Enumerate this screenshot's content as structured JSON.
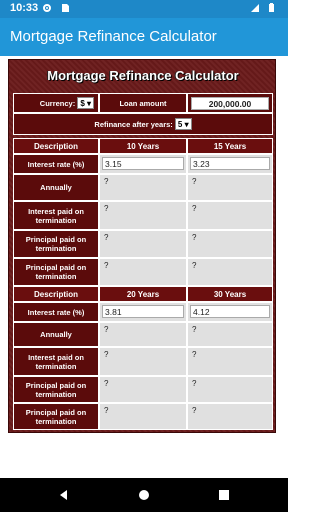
{
  "status": {
    "time": "10:33"
  },
  "appbar": {
    "title": "Mortgage Refinance Calculator"
  },
  "panel": {
    "title": "Mortgage Refinance Calculator",
    "currency_label": "Currency:",
    "currency_value": "$ ▾",
    "loan_label": "Loan amount",
    "loan_value": "200,000.00",
    "refinance_label": "Refinance after years:",
    "refinance_value": "5 ▾"
  },
  "sections": [
    {
      "desc_header": "Description",
      "col1_header": "10 Years",
      "col2_header": "15 Years",
      "rate_label": "Interest rate (%)",
      "rate1": "3.15",
      "rate2": "3.23",
      "rows": [
        {
          "label": "Annually",
          "v1": "?",
          "v2": "?"
        },
        {
          "label": "Interest paid on termination",
          "v1": "?",
          "v2": "?"
        },
        {
          "label": "Principal paid on termination",
          "v1": "?",
          "v2": "?"
        },
        {
          "label": "Principal paid on termination",
          "v1": "?",
          "v2": "?"
        }
      ]
    },
    {
      "desc_header": "Description",
      "col1_header": "20 Years",
      "col2_header": "30 Years",
      "rate_label": "Interest rate (%)",
      "rate1": "3.81",
      "rate2": "4.12",
      "rows": [
        {
          "label": "Annually",
          "v1": "?",
          "v2": "?"
        },
        {
          "label": "Interest paid on termination",
          "v1": "?",
          "v2": "?"
        },
        {
          "label": "Principal paid on termination",
          "v1": "?",
          "v2": "?"
        },
        {
          "label": "Principal paid on termination",
          "v1": "?",
          "v2": "?"
        }
      ]
    }
  ]
}
